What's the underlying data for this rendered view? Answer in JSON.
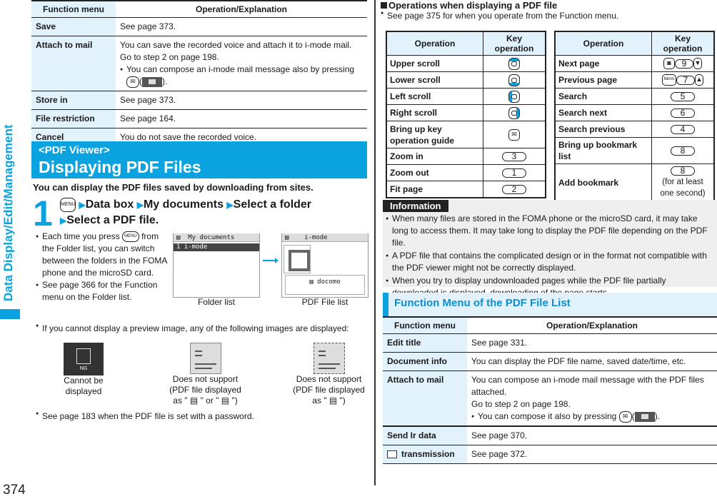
{
  "side_tab": {
    "label": "Data Display/Edit/Management",
    "color": "#0aa3e0"
  },
  "page_number": "374",
  "top_table": {
    "headers": [
      "Function menu",
      "Operation/Explanation"
    ],
    "rows": [
      {
        "menu": "Save",
        "lines": [
          "See page 373."
        ]
      },
      {
        "menu": "Attach to mail",
        "lines": [
          "You can save the recorded voice and attach it to i-mode mail.",
          "Go to step 2 on page 198."
        ],
        "bullet": "You can compose an i-mode mail message also by pressing",
        "bullet_suffix": ")."
      },
      {
        "menu": "Store in",
        "lines": [
          "See page 373."
        ]
      },
      {
        "menu": "File restriction",
        "lines": [
          "See page 164."
        ]
      },
      {
        "menu": "Cancel",
        "lines": [
          "You do not save the recorded voice."
        ]
      }
    ]
  },
  "section": {
    "subtitle": "<PDF Viewer>",
    "title": "Displaying PDF Files",
    "intro": "You can display the PDF files saved by downloading from sites.",
    "step_number": "1",
    "menu_key": "MENU",
    "step_items": [
      "Data box",
      "My documents",
      "Select a folder",
      "Select a PDF file."
    ],
    "bullets": [
      "Each time you press",
      "from the Folder list, you can switch between the folders in the FOMA phone and the microSD card.",
      "See page 366 for the Function menu on the Folder list."
    ],
    "screens": {
      "folder_list": {
        "title": "My documents",
        "row": "1 i-mode",
        "caption": "Folder list"
      },
      "pdf_list": {
        "title": "i-mode",
        "item": "docomo",
        "caption": "PDF File list"
      }
    },
    "no_preview_note": "If you cannot display a preview image, any of the following images are displayed:",
    "previews": [
      {
        "icon": "ng-icon",
        "icon_label": "NG",
        "line1": "Cannot be",
        "line2": "displayed",
        "line3": ""
      },
      {
        "icon": "doc-icon",
        "line1": "Does not support",
        "line2": "(PDF file displayed",
        "line3": "as \" ▤ \" or \" ▤ \")"
      },
      {
        "icon": "doc-dashed-icon",
        "line1": "Does not support",
        "line2": "(PDF file displayed",
        "line3": "as \" ▤ \")"
      }
    ],
    "password_note": "See page 183 when the PDF file is set with a password."
  },
  "operations": {
    "heading": "Operations when displaying a PDF file",
    "note": "See page 375 for when you operate from the Function menu.",
    "left_table": {
      "headers": [
        "Operation",
        "Key operation"
      ],
      "rows": [
        {
          "op": "Upper scroll",
          "key": "dpad-up"
        },
        {
          "op": "Lower scroll",
          "key": "dpad-down"
        },
        {
          "op": "Left scroll",
          "key": "dpad-left"
        },
        {
          "op": "Right scroll",
          "key": "dpad-right"
        },
        {
          "op": "Bring up key operation guide",
          "key": "mail"
        },
        {
          "op": "Zoom in",
          "key": "3"
        },
        {
          "op": "Zoom out",
          "key": "1"
        },
        {
          "op": "Fit page",
          "key": "2"
        }
      ]
    },
    "right_table": {
      "headers": [
        "Operation",
        "Key operation"
      ],
      "rows": [
        {
          "op": "Next page",
          "keys": [
            "camera",
            "9",
            "▼"
          ]
        },
        {
          "op": "Previous page",
          "keys": [
            "MENU",
            "7",
            "▲"
          ]
        },
        {
          "op": "Search",
          "keys": [
            "5"
          ]
        },
        {
          "op": "Search next",
          "keys": [
            "6"
          ]
        },
        {
          "op": "Search previous",
          "keys": [
            "4"
          ]
        },
        {
          "op": "Bring up bookmark list",
          "keys": [
            "8"
          ]
        },
        {
          "op": "Add bookmark",
          "keys": [
            "8"
          ],
          "note": "(for at least one second)"
        }
      ]
    }
  },
  "information": {
    "tag": "Information",
    "bullets": [
      "When many files are stored in the FOMA phone or the microSD card, it may take long to access them. It may take long to display the PDF file depending on the PDF file.",
      "A PDF file that contains the complicated design or in the format not compatible with the PDF viewer might not be correctly displayed.",
      "When you try to display undownloaded pages while the PDF file partially downloaded is displayed, downloading of the page starts."
    ]
  },
  "pdf_function_menu": {
    "title": "Function Menu of the PDF File List",
    "headers": [
      "Function menu",
      "Operation/Explanation"
    ],
    "rows": [
      {
        "menu": "Edit title",
        "lines": [
          "See page 331."
        ]
      },
      {
        "menu": "Document info",
        "lines": [
          "You can display the PDF file name, saved date/time, etc."
        ]
      },
      {
        "menu": "Attach to mail",
        "lines": [
          "You can compose an i-mode mail message with the PDF files attached.",
          "Go to step 2 on page 198."
        ],
        "bullet": "You can compose it also by pressing",
        "bullet_suffix": ")."
      },
      {
        "menu": "Send Ir data",
        "lines": [
          "See page 370."
        ]
      },
      {
        "menu": "transmission",
        "icon": "ic-transmission-icon",
        "lines": [
          "See page 372."
        ]
      }
    ]
  }
}
